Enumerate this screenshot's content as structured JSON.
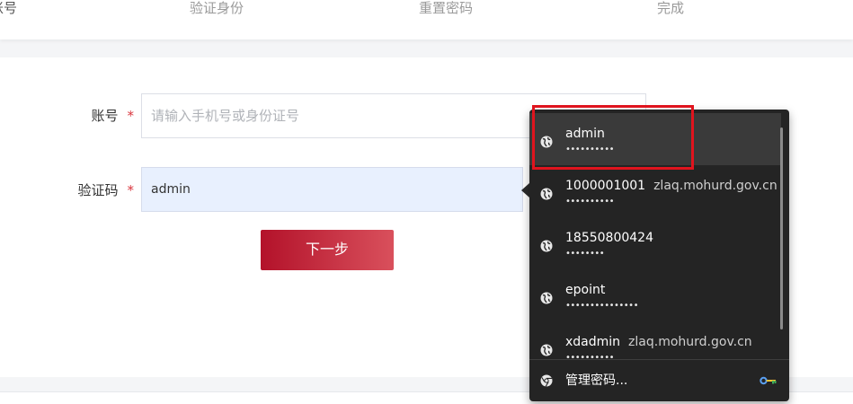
{
  "steps": {
    "step1": "账号",
    "step2": "验证身份",
    "step3": "重置密码",
    "step4": "完成"
  },
  "form": {
    "account_label": "账号",
    "account_placeholder": "请输入手机号或身份证号",
    "captcha_label": "验证码",
    "captcha_value": "admin",
    "required_mark": "*",
    "next_button": "下一步"
  },
  "autofill": {
    "entries": [
      {
        "username": "admin",
        "site": "",
        "password_mask": "••••••••••",
        "icon": "globe-icon",
        "highlighted": true
      },
      {
        "username": "1000001001",
        "site": "zlaq.mohurd.gov.cn",
        "password_mask": "••••••••••",
        "icon": "globe-icon",
        "highlighted": false
      },
      {
        "username": "18550800424",
        "site": "",
        "password_mask": "••••••••",
        "icon": "globe-icon",
        "highlighted": false
      },
      {
        "username": "epoint",
        "site": "",
        "password_mask": "•••••••••••••••",
        "icon": "globe-icon",
        "highlighted": false
      },
      {
        "username": "xdadmin",
        "site": "zlaq.mohurd.gov.cn",
        "password_mask": "••••••••••",
        "icon": "globe-icon",
        "highlighted": false
      }
    ],
    "manage_label": "管理密码...",
    "manage_icon": "chrome-icon",
    "key_icon": "key-icon"
  },
  "colors": {
    "accent": "#b3122a",
    "highlight_annotation": "#e0141e",
    "dropdown_bg": "#242424"
  }
}
